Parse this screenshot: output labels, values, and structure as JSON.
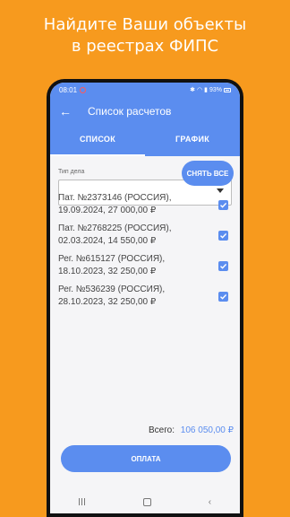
{
  "promo": {
    "line1": "Найдите Ваши объекты",
    "line2": "в реестрах ФИПС"
  },
  "status": {
    "time": "08:01",
    "battery": "93%"
  },
  "toolbar": {
    "title": "Список расчетов"
  },
  "tabs": [
    {
      "label": "СПИСОК",
      "active": true
    },
    {
      "label": "ГРАФИК",
      "active": false
    }
  ],
  "form": {
    "case_type_label": "Тип дела",
    "case_type_value": ""
  },
  "clear_button": "СНЯТЬ ВСЕ",
  "items": [
    {
      "line1": "Пат. №2373146 (РОССИЯ),",
      "line2": "19.09.2024, 27 000,00 ₽",
      "checked": true
    },
    {
      "line1": "Пат. №2768225 (РОССИЯ),",
      "line2": "02.03.2024, 14 550,00 ₽",
      "checked": true
    },
    {
      "line1": "Рег. №615127 (РОССИЯ),",
      "line2": "18.10.2023, 32 250,00 ₽",
      "checked": true
    },
    {
      "line1": "Рег. №536239 (РОССИЯ),",
      "line2": "28.10.2023, 32 250,00 ₽",
      "checked": true
    }
  ],
  "total": {
    "label": "Всего:",
    "value": "106 050,00 ₽"
  },
  "pay_button": "ОПЛАТА",
  "colors": {
    "background": "#F79A1E",
    "accent": "#5B8DEF"
  }
}
